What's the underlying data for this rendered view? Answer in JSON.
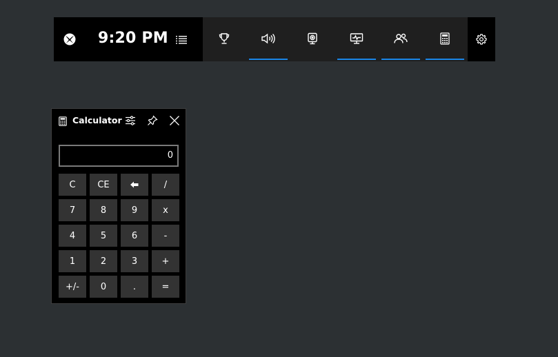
{
  "gamebar": {
    "time": "9:20 PM",
    "logo_icon": "xbox-logo-icon",
    "menu_icon": "menu-icon",
    "widgets": [
      {
        "name": "achievements",
        "icon": "trophy-icon",
        "active": false
      },
      {
        "name": "audio",
        "icon": "speaker-icon",
        "active": true
      },
      {
        "name": "capture",
        "icon": "webcam-icon",
        "active": false
      },
      {
        "name": "performance",
        "icon": "monitor-icon",
        "active": true
      },
      {
        "name": "social",
        "icon": "people-icon",
        "active": true
      },
      {
        "name": "calculator",
        "icon": "calculator-icon",
        "active": true
      }
    ],
    "settings_icon": "gear-icon",
    "accent_color": "#1a86e8"
  },
  "calculator": {
    "title": "Calculator",
    "display": "0",
    "header_icons": [
      "calculator-icon",
      "sliders-icon",
      "pin-icon",
      "close-icon"
    ],
    "keys": [
      [
        "C",
        "CE",
        "⬅",
        "/"
      ],
      [
        "7",
        "8",
        "9",
        "x"
      ],
      [
        "4",
        "5",
        "6",
        "-"
      ],
      [
        "1",
        "2",
        "3",
        "+"
      ],
      [
        "+/-",
        "0",
        ".",
        "="
      ]
    ]
  }
}
